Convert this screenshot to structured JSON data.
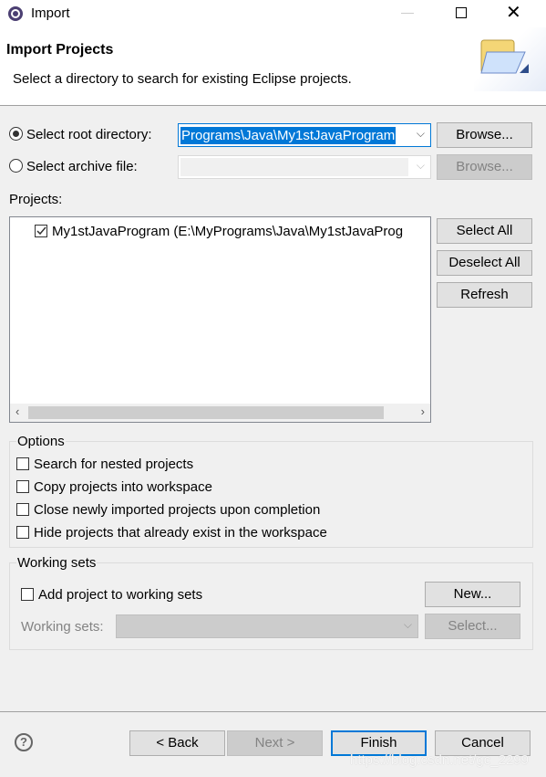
{
  "window": {
    "title": "Import",
    "icon": "eclipse-icon"
  },
  "header": {
    "title": "Import Projects",
    "description": "Select a directory to search for existing Eclipse projects."
  },
  "source": {
    "root_label": "Select root directory:",
    "root_value": "Programs\\Java\\My1stJavaProgram",
    "root_selected": true,
    "archive_label": "Select archive file:",
    "archive_value": "",
    "browse": "Browse..."
  },
  "projects": {
    "label": "Projects:",
    "items": [
      {
        "label": "My1stJavaProgram (E:\\MyPrograms\\Java\\My1stJavaProg",
        "checked": true
      }
    ],
    "select_all": "Select All",
    "deselect_all": "Deselect All",
    "refresh": "Refresh"
  },
  "options": {
    "title": "Options",
    "items": [
      {
        "label": "Search for nested projects",
        "checked": false
      },
      {
        "label": "Copy projects into workspace",
        "checked": false
      },
      {
        "label": "Close newly imported projects upon completion",
        "checked": false
      },
      {
        "label": "Hide projects that already exist in the workspace",
        "checked": false
      }
    ]
  },
  "working_sets": {
    "title": "Working sets",
    "add_label": "Add project to working sets",
    "add_checked": false,
    "new": "New...",
    "sets_label": "Working sets:",
    "select": "Select..."
  },
  "footer": {
    "back": "< Back",
    "next": "Next >",
    "finish": "Finish",
    "cancel": "Cancel"
  },
  "watermark": "https://blog.csdn.net/gc_2299",
  "colors": {
    "accent": "#0078d7"
  }
}
